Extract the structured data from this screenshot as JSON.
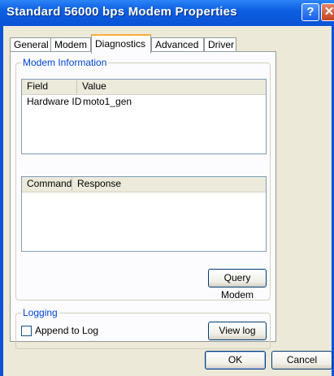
{
  "window": {
    "title": "Standard 56000 bps Modem Properties",
    "help_glyph": "?",
    "close_glyph": "✕"
  },
  "tabs": [
    {
      "label": "General"
    },
    {
      "label": "Modem"
    },
    {
      "label": "Diagnostics"
    },
    {
      "label": "Advanced"
    },
    {
      "label": "Driver"
    }
  ],
  "active_tab": "Diagnostics",
  "modem_info": {
    "group_label": "Modem Information",
    "columns": [
      "Field",
      "Value"
    ],
    "rows": [
      {
        "field": "Hardware ID",
        "value": "moto1_gen"
      }
    ]
  },
  "command_list": {
    "columns": [
      "Command",
      "Response"
    ],
    "rows": []
  },
  "query_modem_label": "Query Modem",
  "logging": {
    "group_label": "Logging",
    "append_label": "Append to Log",
    "append_checked": false,
    "view_log_label": "View log"
  },
  "footer": {
    "ok_label": "OK",
    "cancel_label": "Cancel"
  },
  "colors": {
    "title_bar": "#0a52d6",
    "face": "#ece9d8",
    "group_label": "#0046d5",
    "active_tab_accent": "#f7b03c"
  }
}
